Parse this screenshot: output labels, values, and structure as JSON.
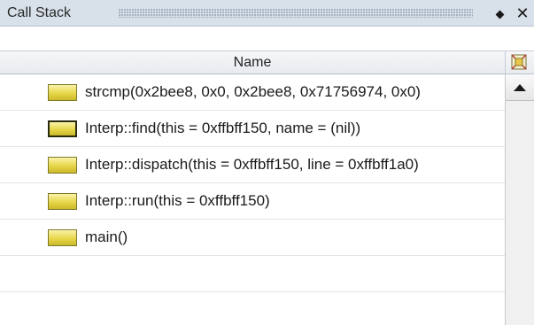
{
  "panel": {
    "title": "Call Stack",
    "pin_glyph": "◆",
    "close_glyph": "✕"
  },
  "table": {
    "column_header": "Name",
    "rows": [
      {
        "label": "strcmp(0x2bee8, 0x0, 0x2bee8, 0x71756974, 0x0)",
        "current": false
      },
      {
        "label": "Interp::find(this = 0xffbff150, name = (nil))",
        "current": true
      },
      {
        "label": "Interp::dispatch(this = 0xffbff150, line = 0xffbff1a0)",
        "current": false
      },
      {
        "label": "Interp::run(this = 0xffbff150)",
        "current": false
      },
      {
        "label": "main()",
        "current": false
      }
    ]
  },
  "icons": {
    "frame": "stack-frame-icon",
    "column_toggle": "column-toggle-icon",
    "scroll_up": "scroll-up-arrow-icon"
  },
  "colors": {
    "title_bg": "#d8e0ea",
    "frame_icon_fill": "#e7d64a",
    "frame_icon_border": "#7d7a2a"
  }
}
